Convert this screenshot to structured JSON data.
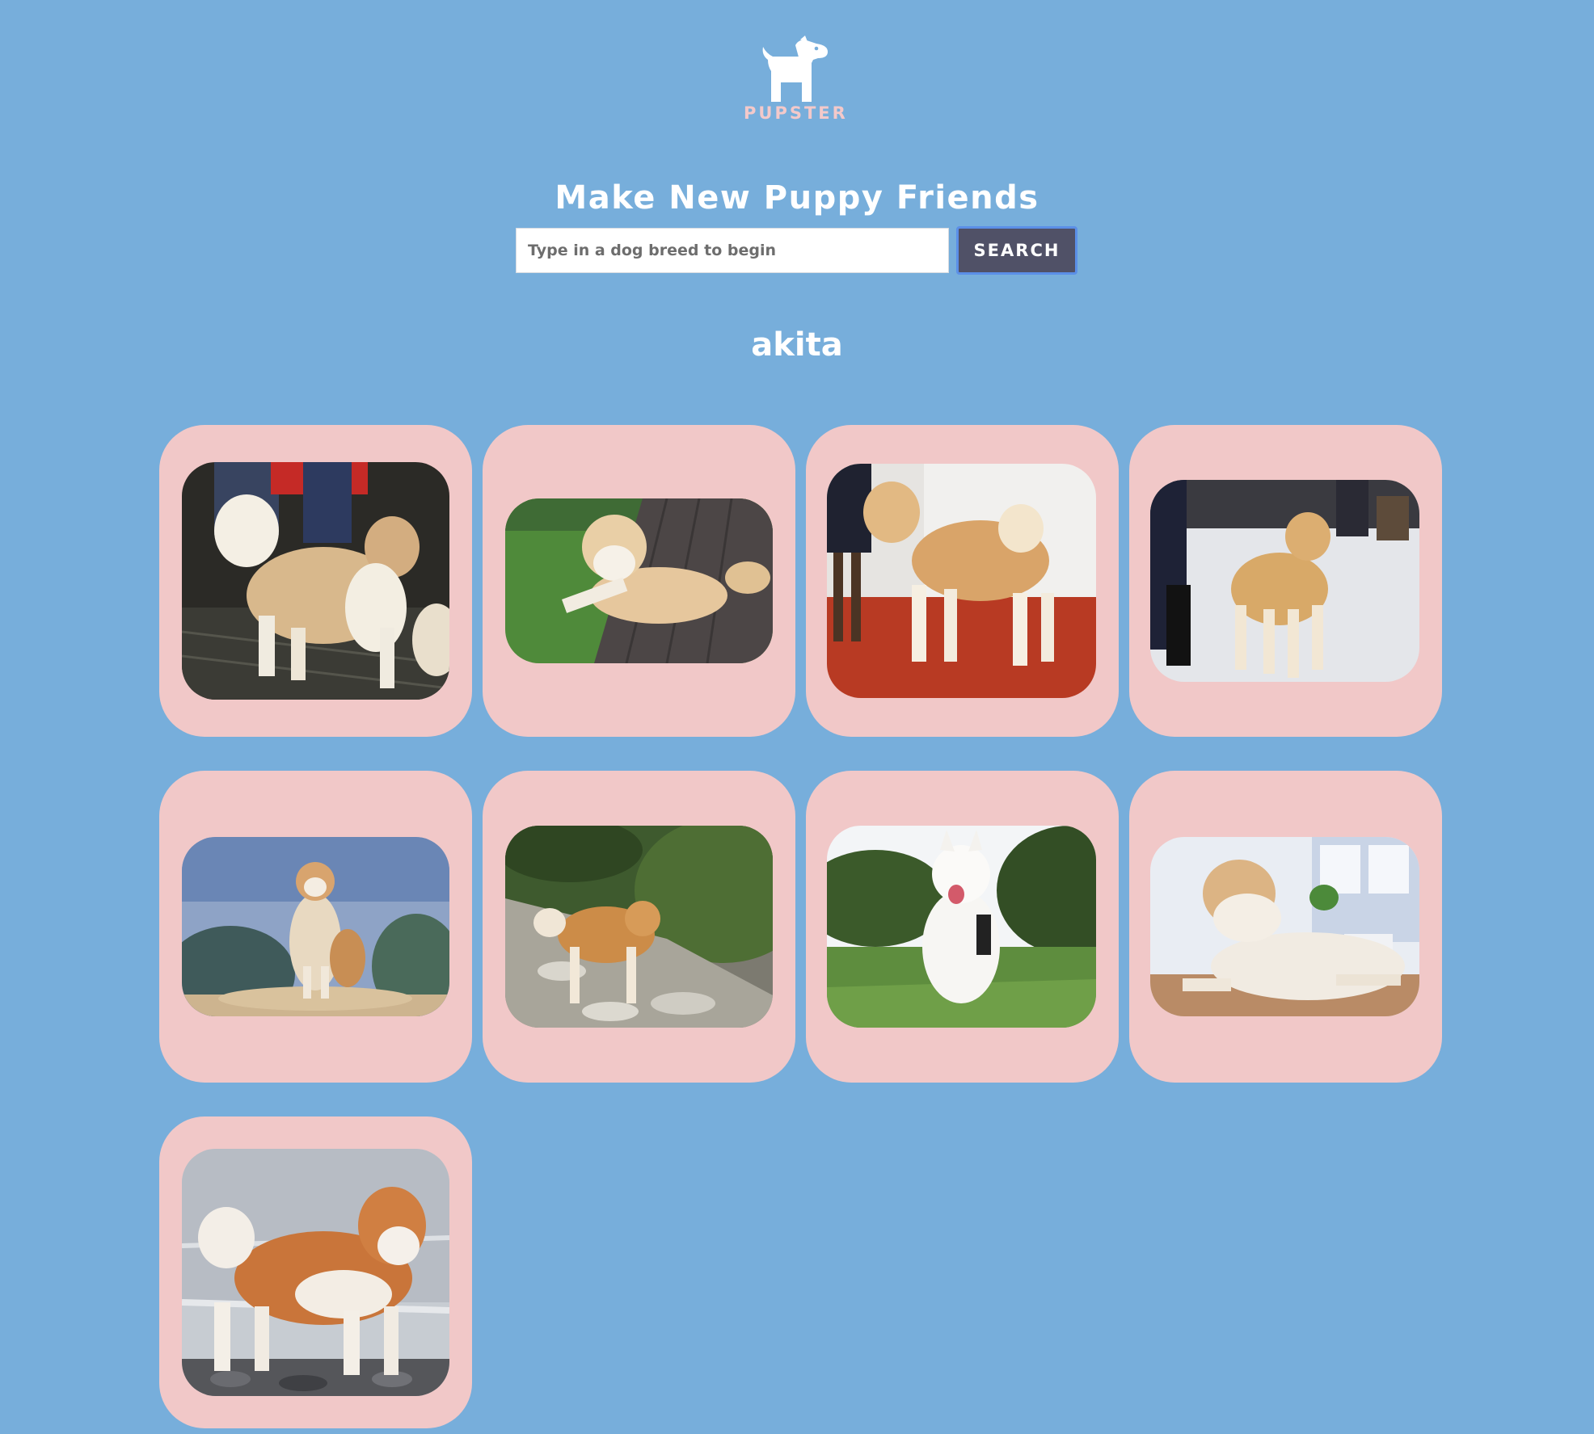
{
  "brand": {
    "name": "PUPSTER",
    "logo_icon": "dog-icon",
    "text_color": "#f3c9ca"
  },
  "page": {
    "background": "#77aedb",
    "headline": "Make New Puppy Friends"
  },
  "search": {
    "placeholder": "Type in a dog breed to begin",
    "value": "",
    "button_label": "SEARCH"
  },
  "results": {
    "breed": "akita",
    "card_color": "#f1c8c8",
    "images": [
      {
        "alt": "akita"
      },
      {
        "alt": "akita"
      },
      {
        "alt": "akita"
      },
      {
        "alt": "akita"
      },
      {
        "alt": "akita"
      },
      {
        "alt": "akita"
      },
      {
        "alt": "akita"
      },
      {
        "alt": "akita"
      },
      {
        "alt": "akita"
      }
    ]
  }
}
